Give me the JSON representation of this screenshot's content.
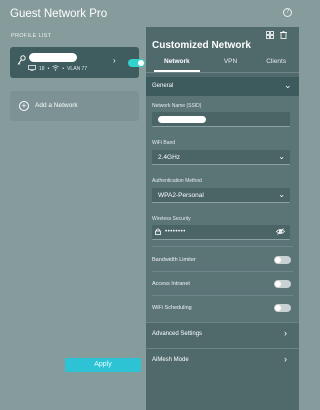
{
  "app": {
    "title": "Guest Network Pro",
    "help_glyph": "?"
  },
  "profile_list": {
    "section_label": "PROFILE LIST",
    "profiles": [
      {
        "name_redacted": true,
        "device_count": "18",
        "vlan": "VLAN 77",
        "enabled": true
      }
    ],
    "add_label": "Add a Network"
  },
  "panel": {
    "title": "Customized Network",
    "tabs": [
      {
        "label": "Network",
        "active": true
      },
      {
        "label": "VPN",
        "active": false
      },
      {
        "label": "Clients",
        "active": false
      }
    ],
    "general": {
      "header": "General",
      "ssid_label": "Network Name (SSID)",
      "ssid_redacted": true,
      "band_label": "WiFi Band",
      "band_value": "2.4GHz",
      "auth_label": "Authentication Method",
      "auth_value": "WPA2-Personal",
      "security_label": "Wireless Security",
      "security_value": "••••••••",
      "toggles": [
        {
          "label": "Bandwidth Limiter",
          "enabled": false
        },
        {
          "label": "Access Intranet",
          "enabled": false
        },
        {
          "label": "WiFi Scheduling",
          "enabled": false
        }
      ]
    },
    "advanced_label": "Advanced Settings",
    "aimesh_label": "AiMesh Mode",
    "apply_label": "Apply"
  },
  "colors": {
    "background": "#869b9b",
    "panel": "#506a6c",
    "accent": "#2ec3d4",
    "toggle_on": "#32d1cc"
  },
  "icons": {
    "profile": "key-icon",
    "devices": "monitor-icon",
    "wifi": "wifi-icon",
    "top_actions": [
      "grid-icon",
      "trash-icon"
    ],
    "security": "lock-icon",
    "visibility": "eye-off-icon"
  }
}
